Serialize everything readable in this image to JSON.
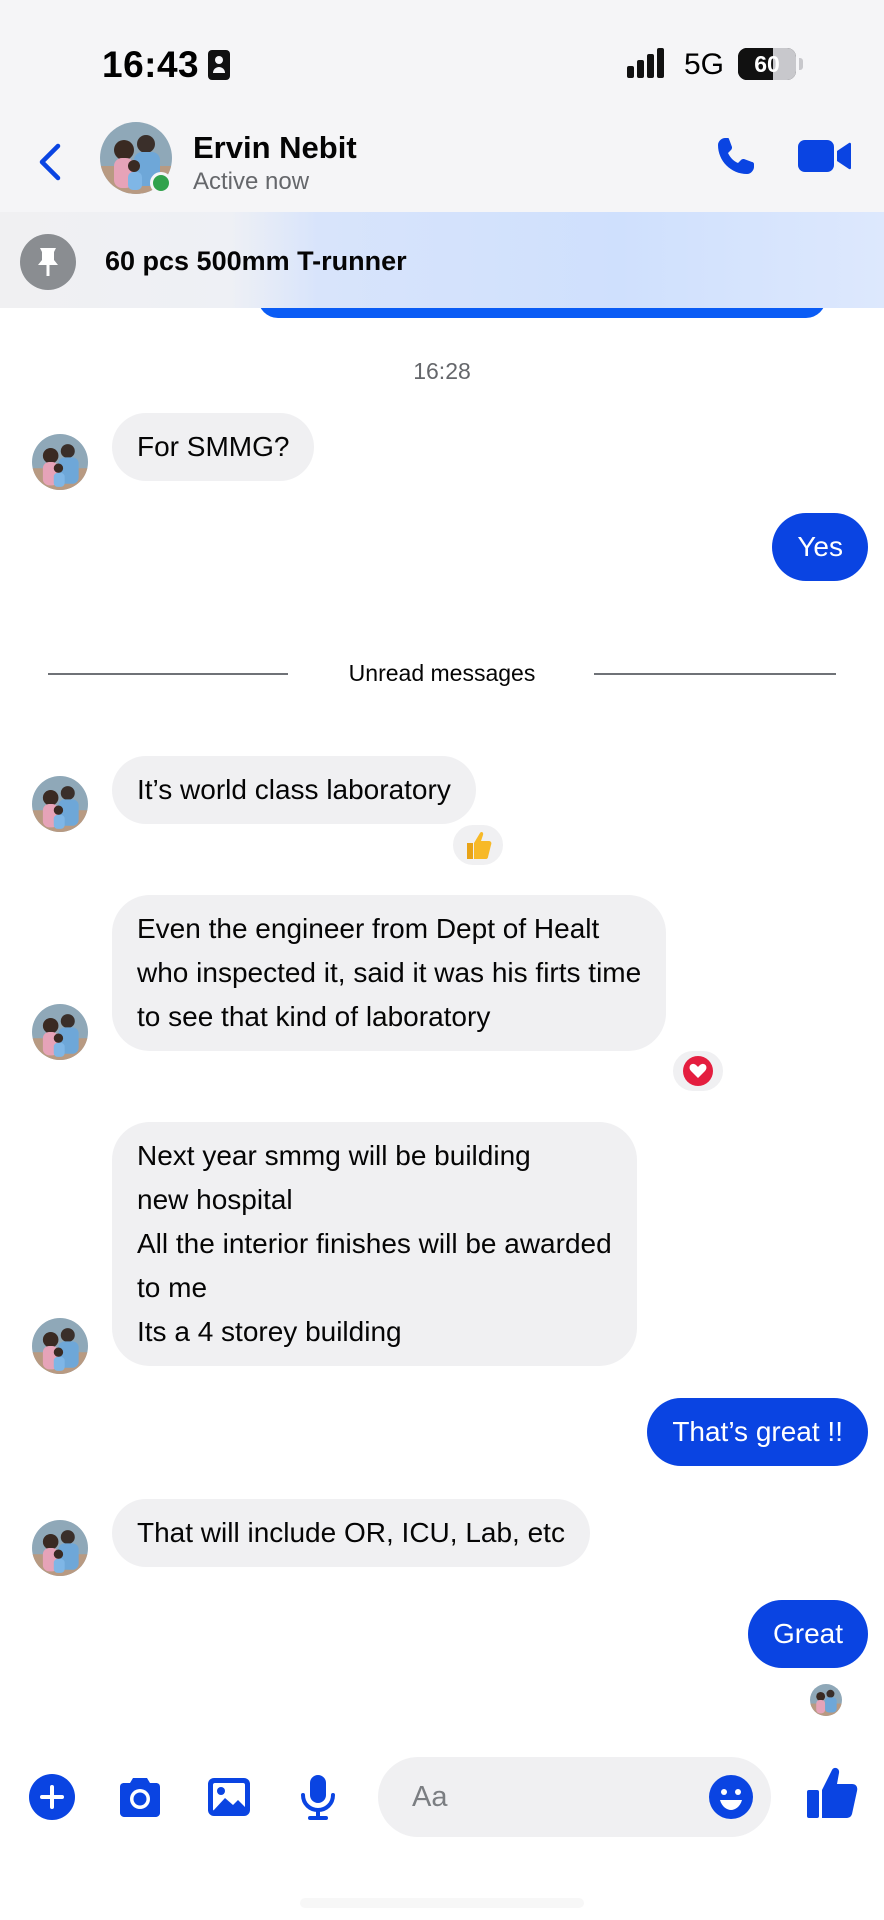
{
  "status_bar": {
    "time": "16:43",
    "network": "5G",
    "battery": "60",
    "battery_level_percent": 60
  },
  "header": {
    "contact_name": "Ervin Nebit",
    "status": "Active now"
  },
  "pinned": {
    "text": "60 pcs 500mm T-runner"
  },
  "chat": {
    "timestamp": "16:28",
    "divider": "Unread messages",
    "messages": [
      {
        "from": "contact",
        "lines": [
          "For SMMG?"
        ]
      },
      {
        "from": "me",
        "lines": [
          "Yes"
        ]
      },
      {
        "from": "contact",
        "lines": [
          "It’s world class laboratory"
        ],
        "reaction": "thumbs-up"
      },
      {
        "from": "contact",
        "lines": [
          "Even the engineer from Dept of Healt",
          "who inspected it, said it was his firts time",
          "to see that kind of laboratory"
        ],
        "reaction": "heart"
      },
      {
        "from": "contact",
        "lines": [
          "Next year smmg will be building",
          "new hospital",
          "All the interior finishes will be awarded",
          "to me",
          "Its a 4 storey building"
        ]
      },
      {
        "from": "me",
        "lines": [
          "That’s great !!"
        ]
      },
      {
        "from": "contact",
        "lines": [
          "That will include OR, ICU, Lab, etc"
        ]
      },
      {
        "from": "me",
        "lines": [
          "Great"
        ]
      }
    ]
  },
  "composer": {
    "placeholder": "Aa"
  },
  "colors": {
    "accent": "#0a44e2",
    "bubble_in": "#f0f0f2",
    "online": "#31a24c",
    "heart": "#e41e3f",
    "thumbs": "#f7b928"
  },
  "icons": [
    "back-arrow",
    "phone",
    "video-camera",
    "pin",
    "thumbs-up",
    "heart",
    "plus",
    "camera",
    "image",
    "microphone",
    "smiley",
    "like"
  ]
}
